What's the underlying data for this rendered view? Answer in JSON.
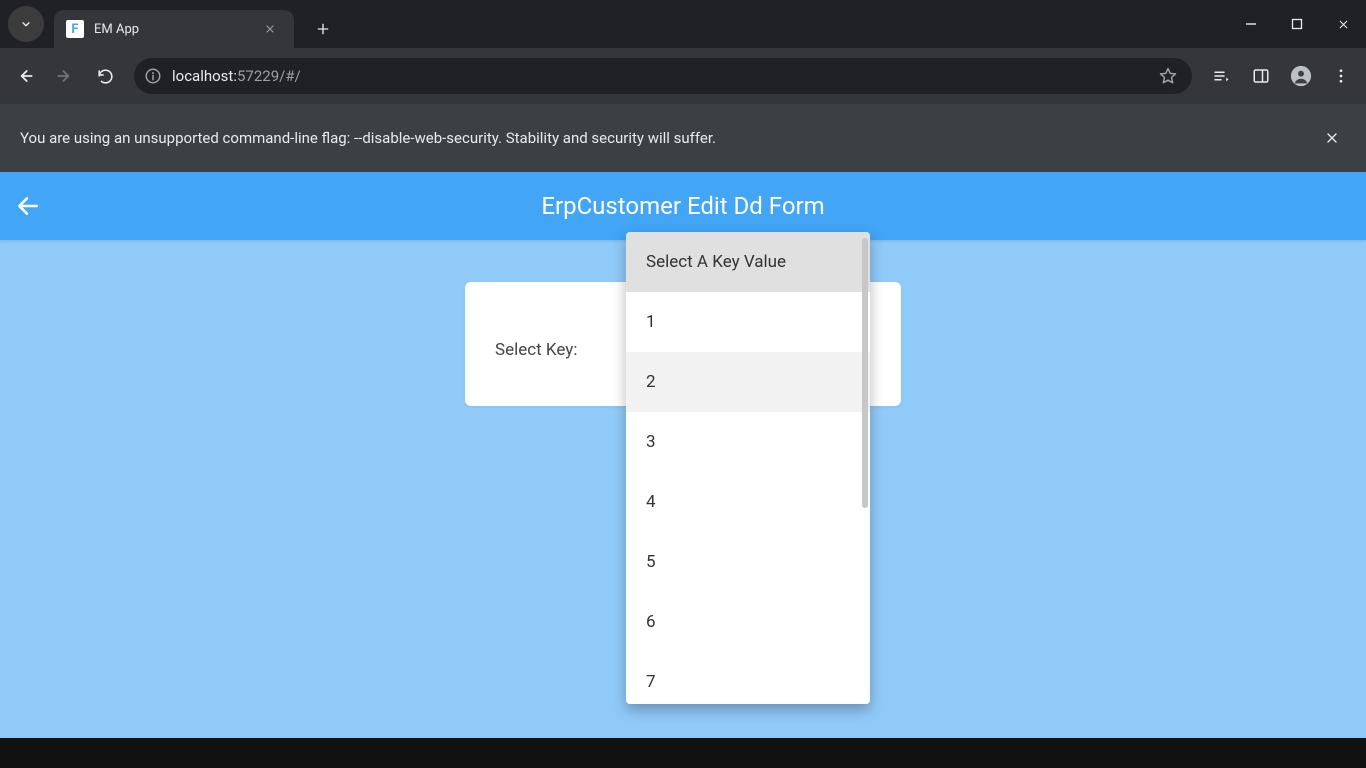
{
  "browser": {
    "tab": {
      "title": "EM App",
      "favicon_letter": "F"
    },
    "url_host": "localhost:",
    "url_rest": "57229/#/",
    "infobar_text": "You are using an unsupported command-line flag: --disable-web-security. Stability and security will suffer."
  },
  "app": {
    "appbar_title": "ErpCustomer Edit Dd Form",
    "select_label": "Select Key:"
  },
  "dropdown": {
    "header": "Select A Key Value",
    "hovered_index": 2,
    "options": [
      "1",
      "2",
      "3",
      "4",
      "5",
      "6",
      "7"
    ]
  }
}
